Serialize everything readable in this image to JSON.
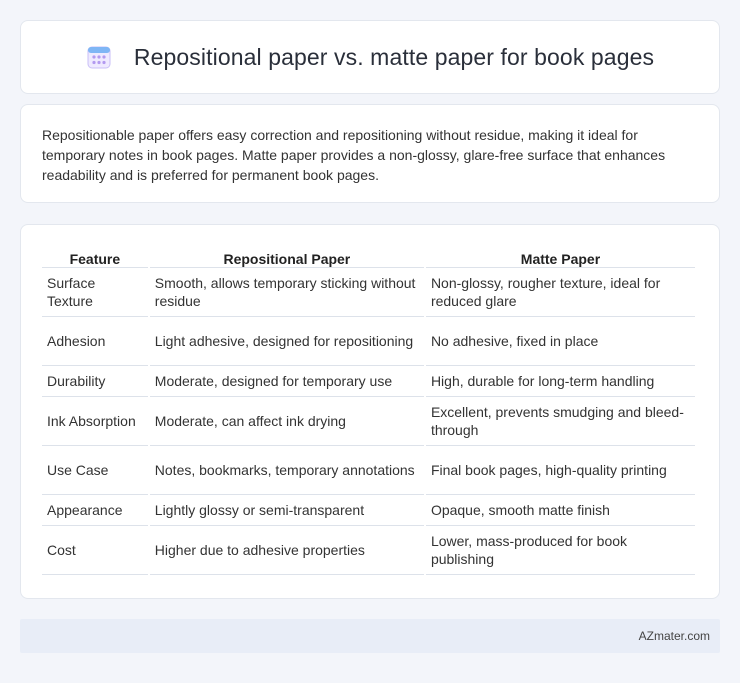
{
  "header": {
    "icon": "calendar-icon",
    "title": "Repositional paper vs. matte paper for book pages"
  },
  "intro": {
    "text": "Repositionable paper offers easy correction and repositioning without residue, making it ideal for temporary notes in book pages. Matte paper provides a non-glossy, glare-free surface that enhances readability and is preferred for permanent book pages."
  },
  "table": {
    "headers": [
      "Feature",
      "Repositional Paper",
      "Matte Paper"
    ],
    "rows": [
      [
        "Surface Texture",
        "Smooth, allows temporary sticking without residue",
        "Non-glossy, rougher texture, ideal for reduced glare"
      ],
      [
        "Adhesion",
        "Light adhesive, designed for repositioning",
        "No adhesive, fixed in place"
      ],
      [
        "Durability",
        "Moderate, designed for temporary use",
        "High, durable for long-term handling"
      ],
      [
        "Ink Absorption",
        "Moderate, can affect ink drying",
        "Excellent, prevents smudging and bleed-through"
      ],
      [
        "Use Case",
        "Notes, bookmarks, temporary annotations",
        "Final book pages, high-quality printing"
      ],
      [
        "Appearance",
        "Lightly glossy or semi-transparent",
        "Opaque, smooth matte finish"
      ],
      [
        "Cost",
        "Higher due to adhesive properties",
        "Lower, mass-produced for book publishing"
      ]
    ]
  },
  "footer": {
    "text": "AZmater.com"
  },
  "colors": {
    "accent_icon": "#8e7cf0",
    "page_bg": "#f3f5fa",
    "footer_bg": "#e8edf7"
  }
}
